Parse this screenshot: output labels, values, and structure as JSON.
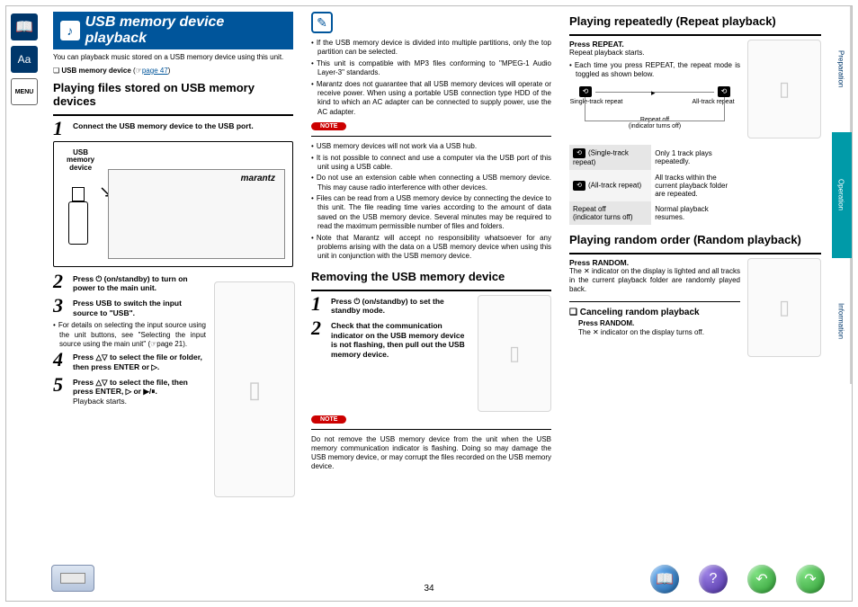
{
  "page_number": "34",
  "left_rail": {
    "book": "📖",
    "aa": "Aa",
    "menu": "MENU"
  },
  "right_rail": {
    "tabs": [
      "Preparation",
      "Operation",
      "Information"
    ],
    "active": 1
  },
  "title": "USB memory device playback",
  "intro": "You can playback music stored on a USB memory device using this unit.",
  "link_line": {
    "prefix": "❏ ",
    "bold": "USB memory device",
    "page_ref": "page 47"
  },
  "col1": {
    "h3": "Playing files stored on USB memory devices",
    "step1": {
      "n": "1",
      "t": "Connect the USB memory device to the USB port."
    },
    "usb_label": "USB\nmemory\ndevice",
    "step2": {
      "n": "2",
      "t": "Press ⏻ (on/standby) to turn on power to the main unit."
    },
    "step3": {
      "n": "3",
      "t": "Press USB to switch the input source to \"USB\"."
    },
    "bullet": "For details on selecting the input source using the unit buttons, see \"Selecting the input source using the main unit\" (☞page 21).",
    "step4": {
      "n": "4",
      "t": "Press △▽ to select the file or folder, then press ENTER or ▷."
    },
    "step5": {
      "n": "5",
      "t": "Press △▽ to select the file, then press ENTER, ▷ or ▶/⏸.",
      "sub": "Playback starts."
    }
  },
  "col2": {
    "top_bullets": [
      "If the USB memory device is divided into multiple partitions, only the top partition can be selected.",
      "This unit is compatible with MP3 files conforming to \"MPEG-1 Audio Layer-3\" standards.",
      "Marantz does not guarantee that all USB memory devices will operate or receive power. When using a portable USB connection type HDD of the kind to which an AC adapter can be connected to supply power, use the AC adapter."
    ],
    "note_label": "NOTE",
    "note_bullets": [
      "USB memory devices will not work via a USB hub.",
      "It is not possible to connect and use a computer via the USB port of this unit using a USB cable.",
      "Do not use an extension cable when connecting a USB memory device. This may cause radio interference with other devices.",
      "Files can be read from a USB memory device by connecting the device to this unit. The file reading time varies according to the amount of data saved on the USB memory device. Several minutes may be required to read the maximum permissible number of files and folders.",
      "Note that Marantz will accept no responsibility whatsoever for any problems arising with the data on a USB memory device when using this unit in conjunction with the USB memory device."
    ],
    "h3": "Removing the USB memory device",
    "step1": {
      "n": "1",
      "t": "Press ⏻ (on/standby) to set the standby mode."
    },
    "step2": {
      "n": "2",
      "t": "Check that the communication indicator on the USB memory device is not flashing, then pull out the USB memory device."
    },
    "note2": "Do not remove the USB memory device from the unit when the USB memory communication indicator is flashing. Doing so may damage the USB memory device, or may corrupt the files recorded on the USB memory device."
  },
  "col3": {
    "h3a": "Playing repeatedly (Repeat playback)",
    "repeat_press": "Press REPEAT.",
    "repeat_sub": "Repeat playback starts.",
    "repeat_each": "Each time you press REPEAT, the repeat mode is toggled as shown below.",
    "diag": {
      "single": "Single-track repeat",
      "all": "All-track repeat",
      "off": "Repeat off\n(indicator turns off)"
    },
    "table": [
      {
        "mode": "(Single-track repeat)",
        "desc": "Only 1 track plays repeatedly."
      },
      {
        "mode": "(All-track repeat)",
        "desc": "All tracks within the current playback folder are repeated."
      },
      {
        "mode": "Repeat off\n(indicator turns off)",
        "desc": "Normal playback resumes."
      }
    ],
    "h3b": "Playing random order (Random playback)",
    "random_press": "Press RANDOM.",
    "random_txt": "The ✕ indicator on the display is lighted and all tracks in the current playback folder are randomly played back.",
    "cancel_h": "❏ Canceling random playback",
    "cancel1": "Press RANDOM.",
    "cancel2": "The ✕ indicator on the display turns off."
  }
}
